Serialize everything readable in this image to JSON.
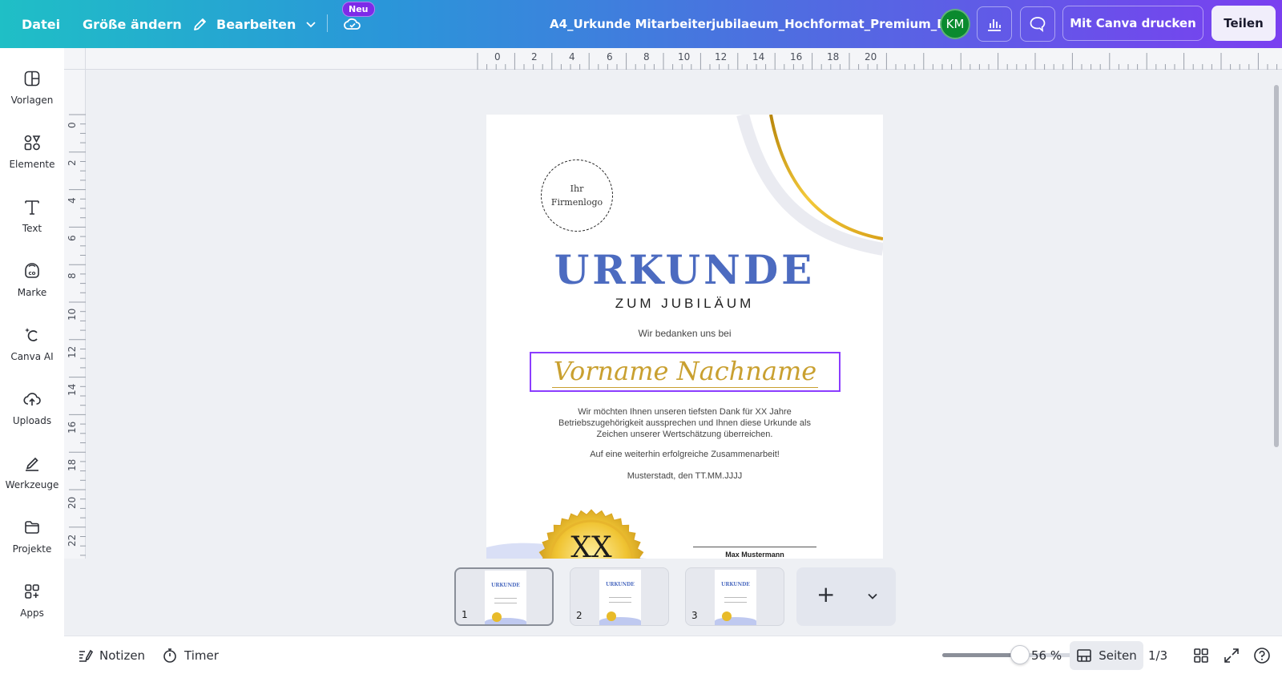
{
  "topbar": {
    "file_label": "Datei",
    "resize_label": "Größe ändern",
    "edit_label": "Bearbeiten",
    "new_badge": "Neu",
    "doc_title": "A4_Urkunde Mitarbeiterjubilaeum_Hochformat_Premium_B...",
    "avatar_initials": "KM",
    "print_label": "Mit Canva drucken",
    "share_label": "Teilen"
  },
  "sidebar": {
    "items": [
      {
        "label": "Vorlagen",
        "icon": "templates-icon"
      },
      {
        "label": "Elemente",
        "icon": "elements-icon"
      },
      {
        "label": "Text",
        "icon": "text-icon"
      },
      {
        "label": "Marke",
        "icon": "brand-icon"
      },
      {
        "label": "Canva AI",
        "icon": "canva-ai-icon"
      },
      {
        "label": "Uploads",
        "icon": "uploads-icon"
      },
      {
        "label": "Werkzeuge",
        "icon": "tools-icon"
      },
      {
        "label": "Projekte",
        "icon": "projects-icon"
      },
      {
        "label": "Apps",
        "icon": "apps-icon"
      }
    ]
  },
  "ruler": {
    "top_labels": [
      "0",
      "2",
      "4",
      "6",
      "8",
      "10",
      "12",
      "14",
      "16",
      "18",
      "20"
    ],
    "left_labels": [
      "0",
      "2",
      "4",
      "6",
      "8",
      "10",
      "12",
      "14",
      "16",
      "18",
      "20",
      "22"
    ]
  },
  "document": {
    "logo_line1": "Ihr",
    "logo_line2": "Firmenlogo",
    "heading": "URKUNDE",
    "subheading": "ZUM JUBILÄUM",
    "thanks": "Wir bedanken uns bei",
    "name": "Vorname Nachname",
    "body_line1": "Wir möchten Ihnen unseren tiefsten Dank für XX Jahre",
    "body_line2": "Betriebszugehörigkeit aussprechen und Ihnen diese Urkunde als",
    "body_line3": "Zeichen unserer Wertschätzung überreichen.",
    "closing": "Auf eine weiterhin erfolgreiche Zusammenarbeit!",
    "place_date": "Musterstadt, den TT.MM.JJJJ",
    "seal_text": "XX",
    "signatory": "Max Mustermann",
    "thumb_heading": "URKUNDE"
  },
  "pages": {
    "thumbnails": [
      {
        "number": "1"
      },
      {
        "number": "2"
      },
      {
        "number": "3"
      }
    ],
    "add_label": "+"
  },
  "bottombar": {
    "notes_label": "Notizen",
    "timer_label": "Timer",
    "zoom_percent": 56,
    "zoom_label": "56 %",
    "pages_label": "Seiten",
    "page_indicator": "1/3"
  },
  "colors": {
    "accent_purple": "#8b3dff",
    "heading_blue": "#4c6bc0",
    "gold": "#c9a030",
    "avatar_green": "#0a8a2e"
  }
}
